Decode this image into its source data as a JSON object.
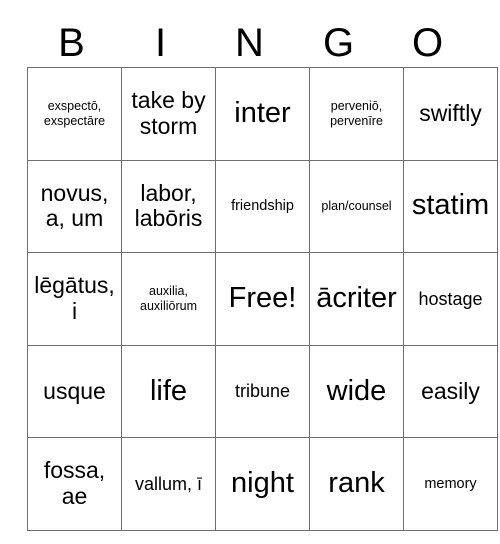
{
  "card": {
    "header": {
      "letters": [
        "B",
        "I",
        "N",
        "G",
        "O"
      ]
    },
    "rows": [
      [
        {
          "text": "exspectō, exspectāre",
          "size": "xs"
        },
        {
          "text": "take by storm",
          "size": "l"
        },
        {
          "text": "inter",
          "size": "xl"
        },
        {
          "text": "perveniō, pervenīre",
          "size": "xs"
        },
        {
          "text": "swiftly",
          "size": "l"
        }
      ],
      [
        {
          "text": "novus, a, um",
          "size": "l"
        },
        {
          "text": "labor, labōris",
          "size": "l"
        },
        {
          "text": "friendship",
          "size": "s"
        },
        {
          "text": "plan/counsel",
          "size": "xs"
        },
        {
          "text": "statim",
          "size": "xl"
        }
      ],
      [
        {
          "text": "lēgātus, i",
          "size": "l"
        },
        {
          "text": "auxilia, auxiliōrum",
          "size": "xs"
        },
        {
          "text": "Free!",
          "size": "xl"
        },
        {
          "text": "ācriter",
          "size": "xl"
        },
        {
          "text": "hostage",
          "size": "m"
        }
      ],
      [
        {
          "text": "usque",
          "size": "l"
        },
        {
          "text": "life",
          "size": "xl"
        },
        {
          "text": "tribune",
          "size": "m"
        },
        {
          "text": "wide",
          "size": "xl"
        },
        {
          "text": "easily",
          "size": "l"
        }
      ],
      [
        {
          "text": "fossa, ae",
          "size": "l"
        },
        {
          "text": "vallum, ī",
          "size": "m"
        },
        {
          "text": "night",
          "size": "xl"
        },
        {
          "text": "rank",
          "size": "xl"
        },
        {
          "text": "memory",
          "size": "s"
        }
      ]
    ]
  },
  "colors": {
    "background": "#ffffff",
    "text": "#000000",
    "grid_line": "#6e6e6e",
    "grid_outer": "#3a3a3a"
  }
}
